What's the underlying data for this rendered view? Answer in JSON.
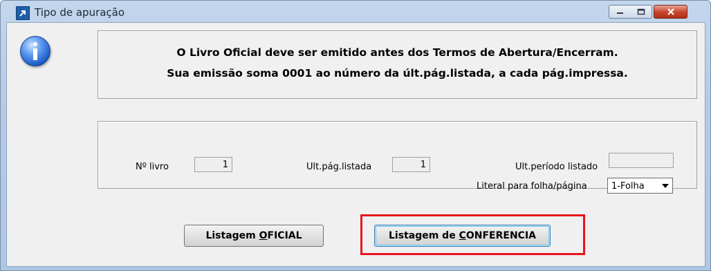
{
  "window": {
    "title": "Tipo de apuração",
    "controls": {
      "minimize": "minimize",
      "maximize": "maximize",
      "close": "close"
    }
  },
  "message": {
    "icon": "info-icon",
    "line1": "O Livro Oficial deve ser emitido antes dos Termos de Abertura/Encerram.",
    "line2": "Sua emissão soma 0001 ao número da últ.pág.listada, a cada pág.impressa."
  },
  "fields": {
    "livro_label": "Nº livro",
    "livro_value": "1",
    "ult_pag_label": "Ult.pág.listada",
    "ult_pag_value": "1",
    "ult_periodo_label": "Ult.período listado",
    "ult_periodo_value": "",
    "literal_label": "Literal para folha/página",
    "literal_selected": "1-Folha"
  },
  "buttons": {
    "oficial": {
      "prefix": "Listagem ",
      "mnemonic": "O",
      "suffix": "FICIAL"
    },
    "conferencia": {
      "prefix": "Listagem de ",
      "mnemonic": "C",
      "suffix": "ONFERENCIA"
    }
  },
  "colors": {
    "highlight": "#e8141c",
    "titlebar": "#b4cbe6",
    "close": "#c8412a"
  }
}
